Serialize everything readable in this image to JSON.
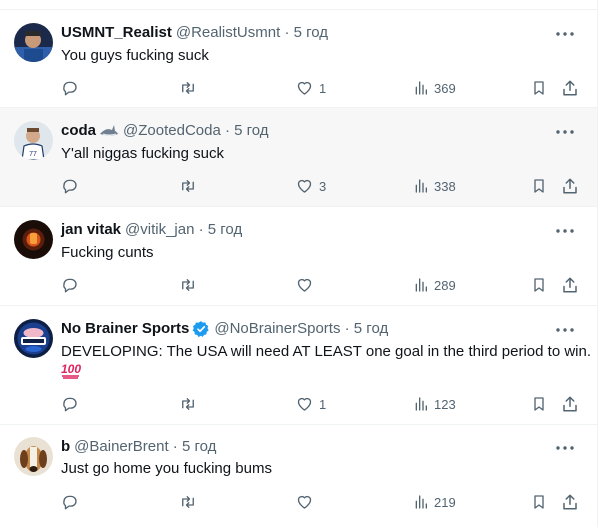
{
  "colors": {
    "text": "#0f1419",
    "secondary": "#536471",
    "border": "#eff3f4",
    "hover_bg": "#f7f7f7",
    "verified": "#1d9bf0"
  },
  "tweets": [
    {
      "display_name": "USMNT_Realist",
      "meta": "@RealistUsmnt · 5 год",
      "text_lines": [
        "You guys fucking suck"
      ],
      "likes": "1",
      "views": "369",
      "replies": "",
      "retweets": ""
    },
    {
      "display_name": "coda",
      "name_badge_icon": "shark-emoji-icon",
      "meta": "@ZootedCoda · 5 год",
      "text_lines": [
        "Y'all niggas fucking suck"
      ],
      "likes": "3",
      "views": "338",
      "replies": "",
      "retweets": ""
    },
    {
      "display_name": "jan vitak",
      "meta": "@vitik_jan · 5 год",
      "text_lines": [
        "Fucking cunts"
      ],
      "likes": "",
      "views": "289",
      "replies": "",
      "retweets": ""
    },
    {
      "display_name": "No Brainer Sports",
      "name_badge_icon": "verified-badge-icon",
      "meta": "@NoBrainerSports · 5 год",
      "text_lines": [
        "DEVELOPING:  The USA will need AT LEAST one goal in the third period to win.",
        ""
      ],
      "trailing_emoji_icon": "hundred-points-emoji-icon",
      "likes": "1",
      "views": "123",
      "replies": "",
      "retweets": ""
    },
    {
      "display_name": "b",
      "meta": "@BainerBrent · 5 год",
      "text_lines": [
        "Just go home you fucking bums"
      ],
      "likes": "",
      "views": "219",
      "replies": "",
      "retweets": ""
    }
  ]
}
